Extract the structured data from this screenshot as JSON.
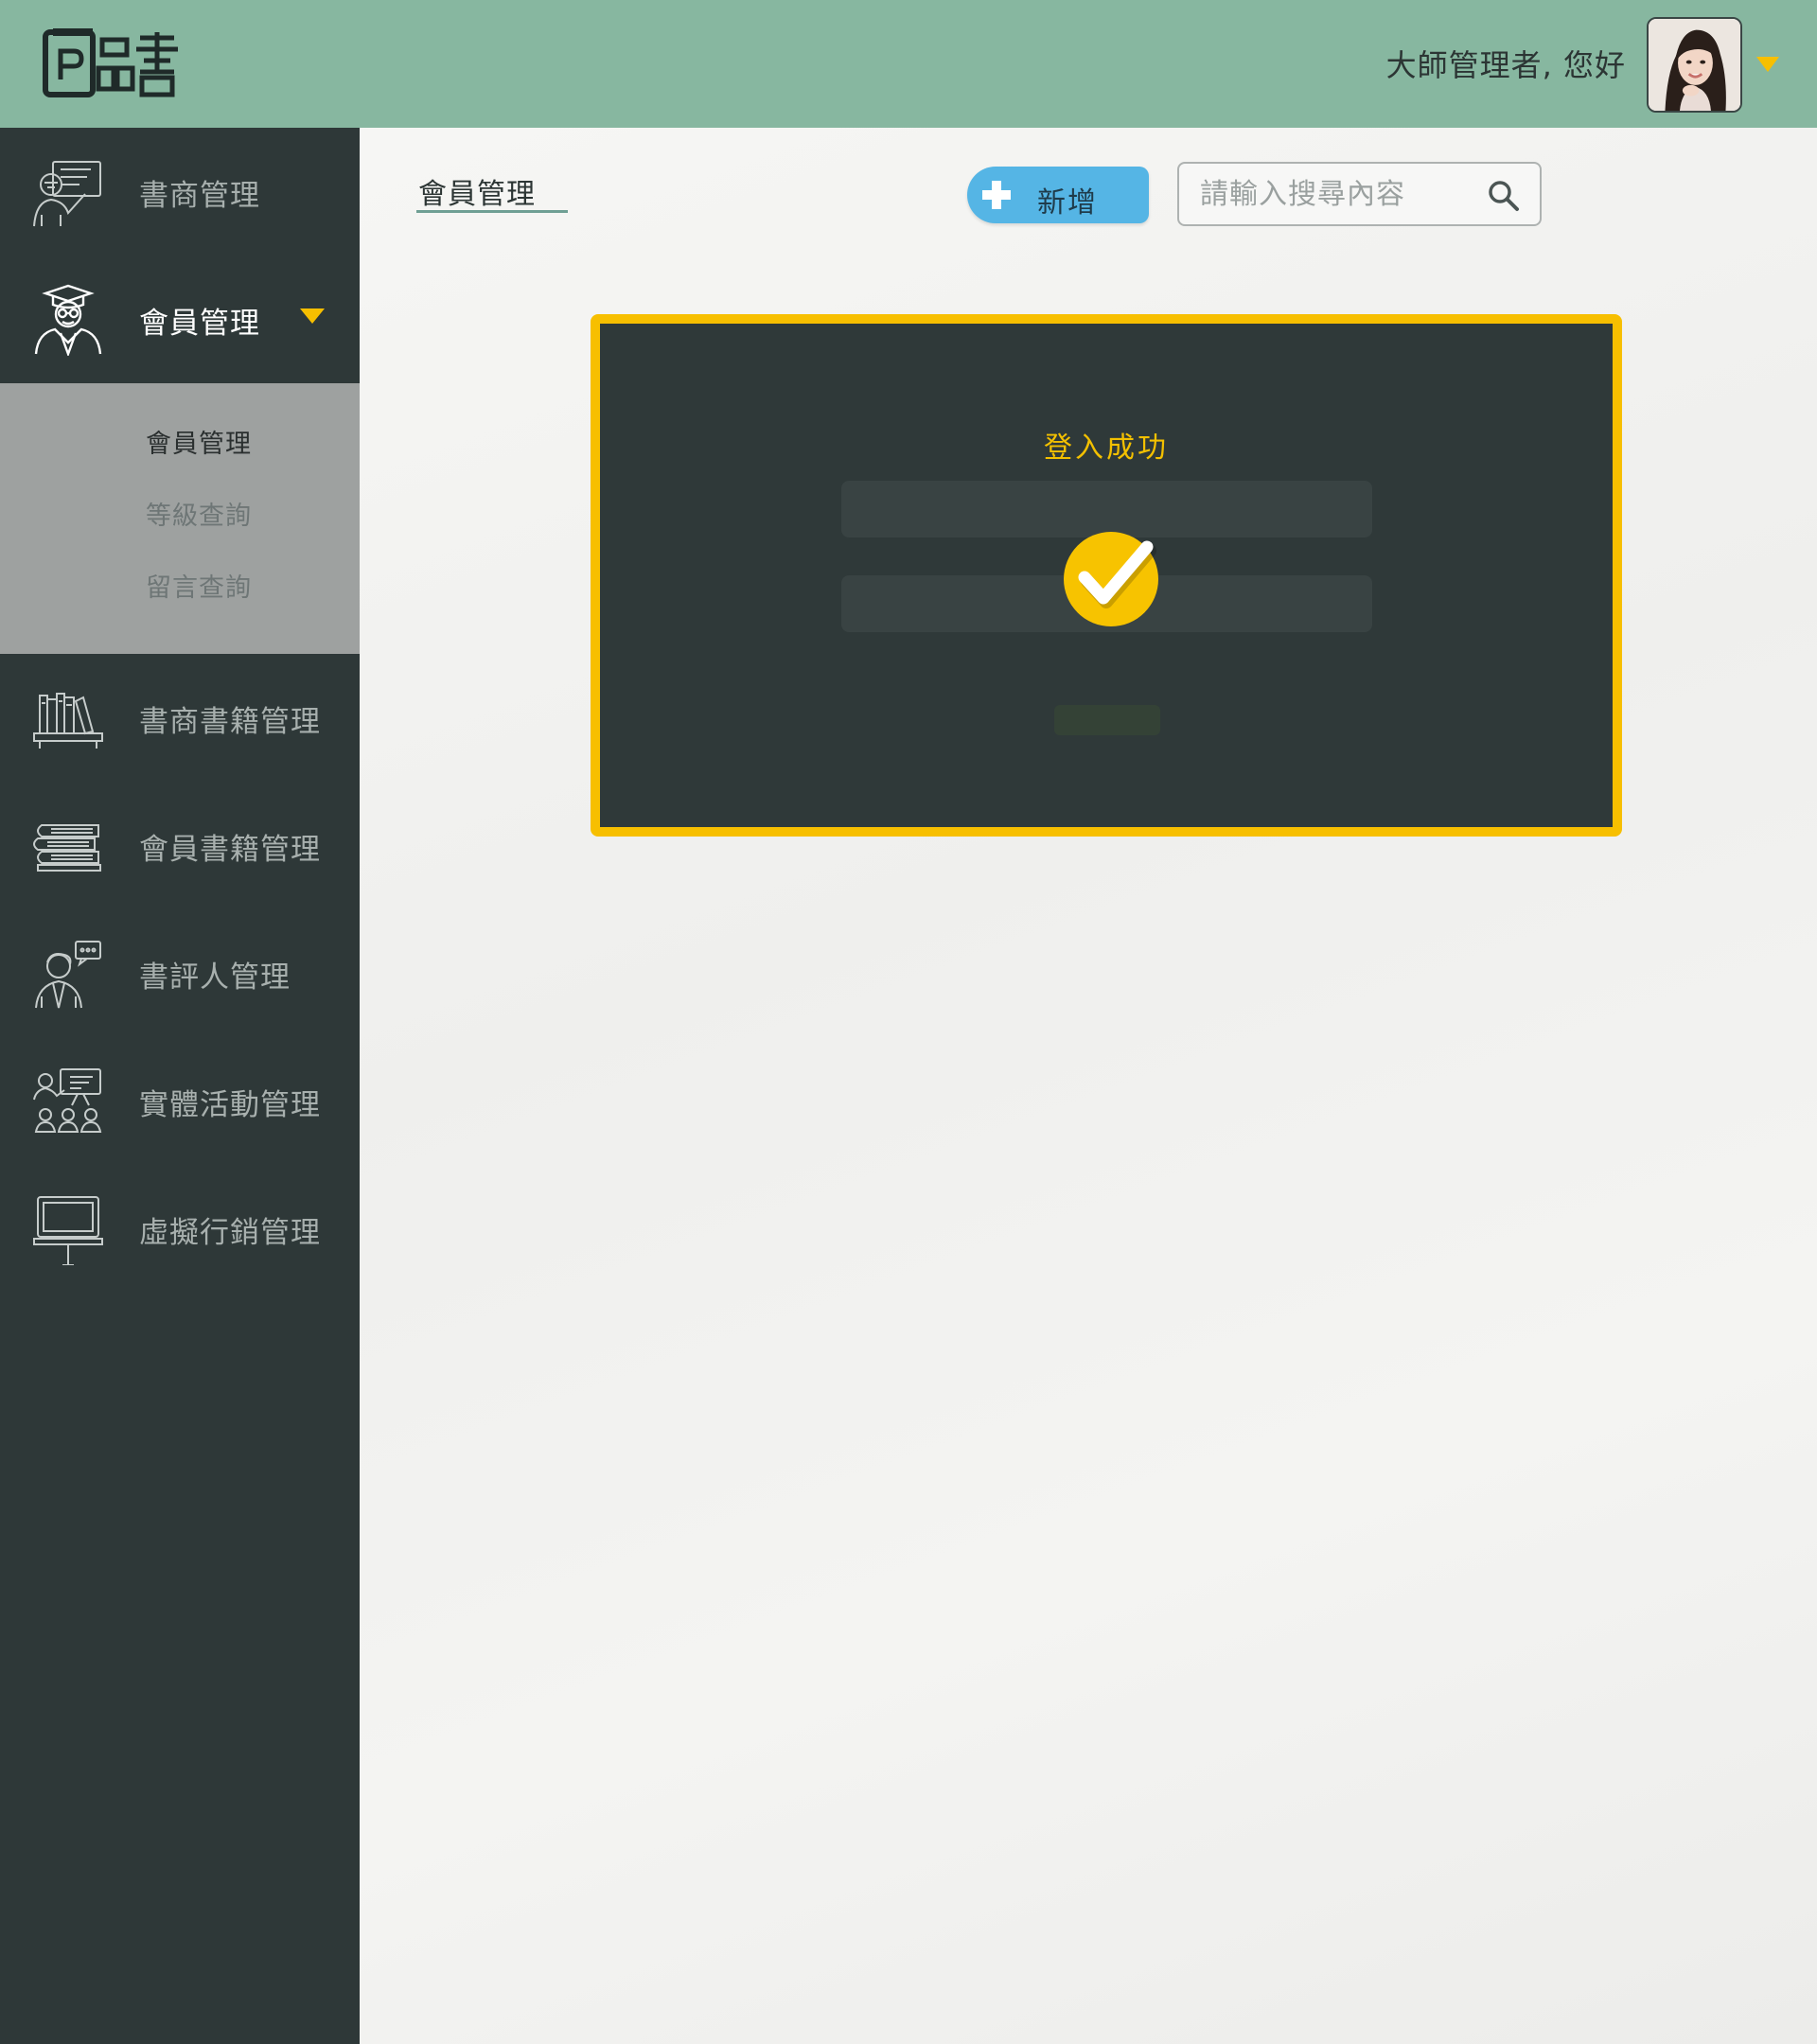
{
  "header": {
    "greeting": "大師管理者, 您好",
    "logo_name": "logo-icon",
    "avatar_name": "admin-avatar"
  },
  "sidebar": {
    "items": [
      {
        "label": "書商管理",
        "icon": "bookseller-presenter-icon"
      },
      {
        "label": "會員管理",
        "icon": "member-graduate-icon",
        "expanded": true
      },
      {
        "label": "書商書籍管理",
        "icon": "bookshelf-icon"
      },
      {
        "label": "會員書籍管理",
        "icon": "book-stack-icon"
      },
      {
        "label": "書評人管理",
        "icon": "reviewer-chat-icon"
      },
      {
        "label": "實體活動管理",
        "icon": "event-audience-icon"
      },
      {
        "label": "虛擬行銷管理",
        "icon": "monitor-marketing-icon"
      }
    ],
    "submenu": [
      {
        "label": "會員管理",
        "active": true
      },
      {
        "label": "等級查詢",
        "active": false
      },
      {
        "label": "留言查詢",
        "active": false
      }
    ]
  },
  "main": {
    "page_title": "會員管理",
    "add_label": "新增",
    "search_placeholder": "請輸入搜尋內容",
    "search_value": ""
  },
  "modal": {
    "title": "登入成功",
    "icon": "success-check-icon"
  },
  "colors": {
    "header_bg": "#87b7a0",
    "sidebar_bg": "#2e3838",
    "submenu_bg": "#9ea1a0",
    "accent_yellow": "#f7bf00",
    "add_button_bg": "#55b5e5",
    "modal_bg": "#2f3939"
  }
}
